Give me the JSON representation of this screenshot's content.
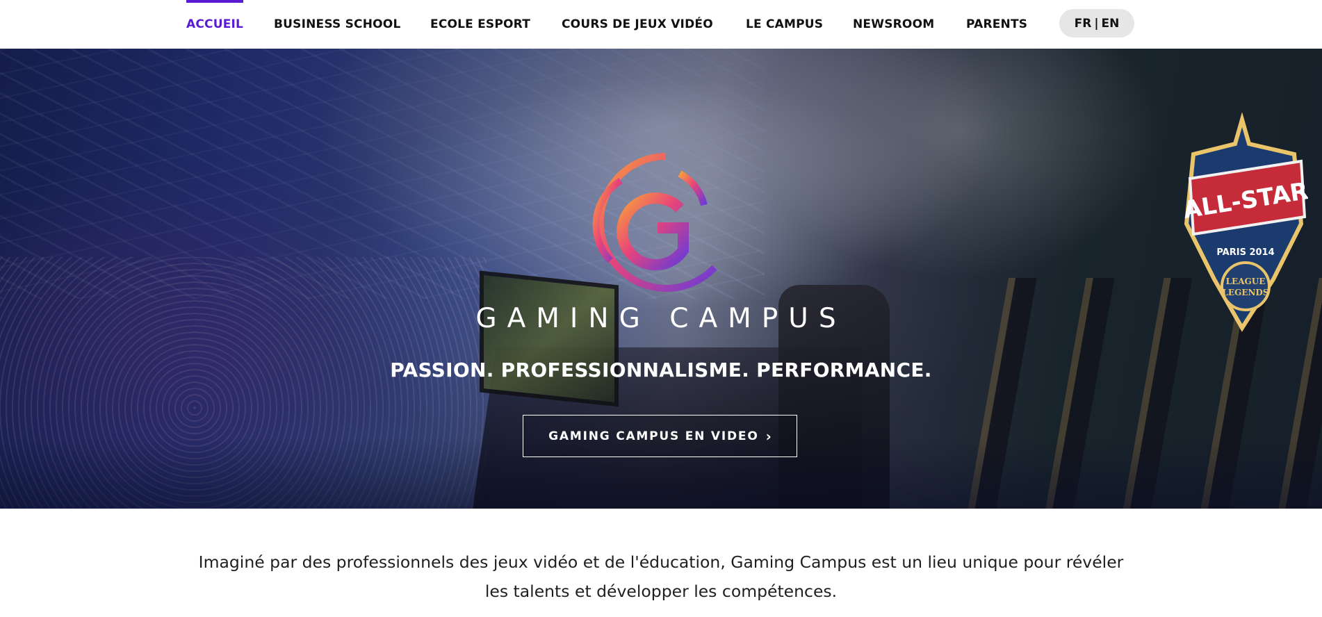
{
  "nav": {
    "items": [
      {
        "label": "ACCUEIL",
        "active": true
      },
      {
        "label": "BUSINESS SCHOOL",
        "active": false
      },
      {
        "label": "ECOLE ESPORT",
        "active": false
      },
      {
        "label": "COURS DE JEUX VIDÉO",
        "active": false
      },
      {
        "label": "LE CAMPUS",
        "active": false
      },
      {
        "label": "NEWSROOM",
        "active": false
      },
      {
        "label": "PARENTS",
        "active": false
      }
    ],
    "lang": {
      "fr": "FR",
      "separator": "|",
      "en": "EN"
    },
    "accent_color": "#5a1ad1"
  },
  "hero": {
    "logo_icon": "gaming-campus-g-logo",
    "title": "GAMING CAMPUS",
    "tagline": "PASSION. PROFESSIONNALISME. PERFORMANCE.",
    "cta_label": "GAMING CAMPUS EN VIDEO",
    "cta_icon": "chevron-right-icon",
    "badge_text": {
      "main": "ALL-STAR",
      "sub": "PARIS 2014",
      "league_line1": "LEAGUE",
      "league_line2": "LEGENDS"
    }
  },
  "intro": {
    "line1": "Imaginé par des professionnels des jeux vidéo et de l'éducation, Gaming Campus est un lieu unique pour révéler",
    "line2": "les talents et développer les compétences."
  }
}
